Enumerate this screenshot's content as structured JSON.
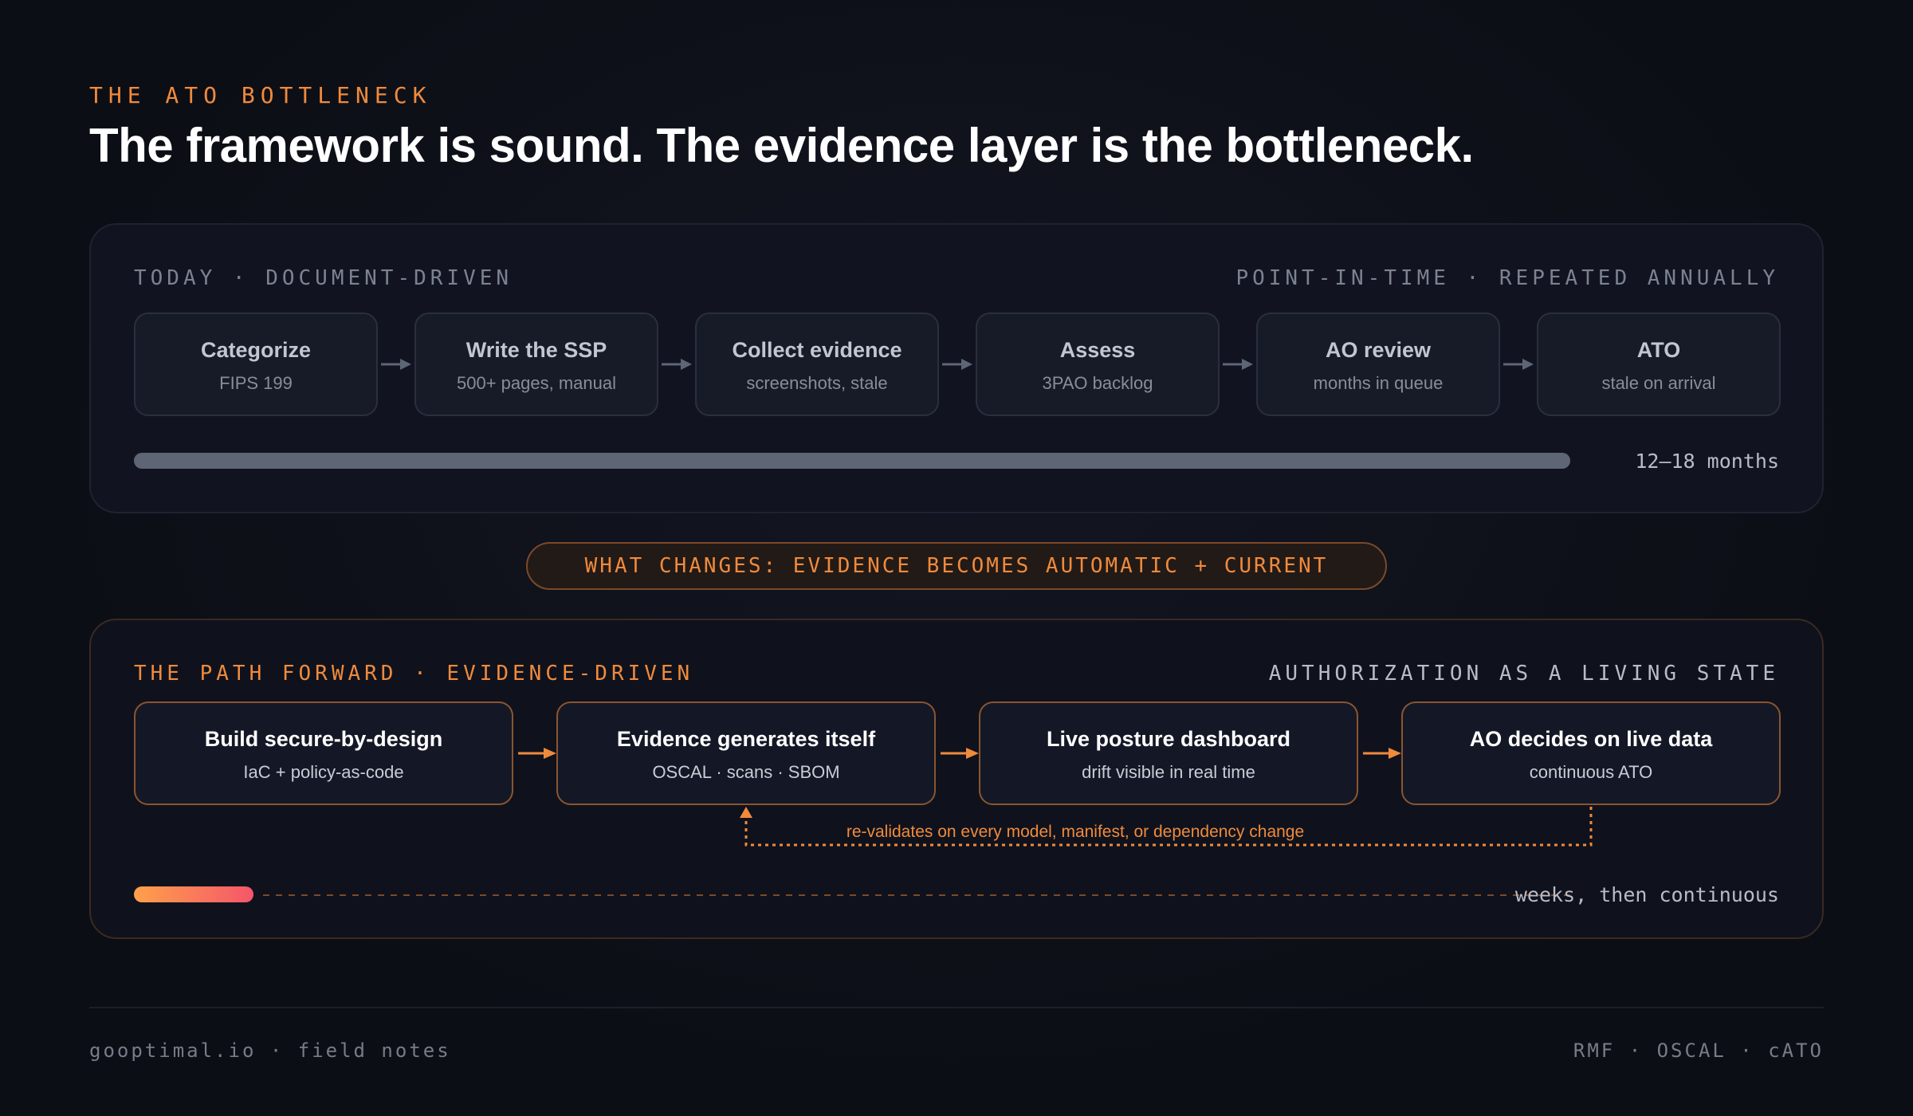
{
  "eyebrow": "THE ATO BOTTLENECK",
  "headline": "The framework is sound. The evidence layer is the bottleneck.",
  "today": {
    "label": "TODAY · DOCUMENT-DRIVEN",
    "cadence": "POINT-IN-TIME · REPEATED ANNUALLY",
    "steps": [
      {
        "title": "Categorize",
        "sub": "FIPS 199"
      },
      {
        "title": "Write the SSP",
        "sub": "500+ pages, manual"
      },
      {
        "title": "Collect evidence",
        "sub": "screenshots, stale"
      },
      {
        "title": "Assess",
        "sub": "3PAO backlog"
      },
      {
        "title": "AO review",
        "sub": "months in queue"
      },
      {
        "title": "ATO",
        "sub": "stale on arrival"
      }
    ],
    "duration": "12–18 months"
  },
  "pill": "WHAT CHANGES: EVIDENCE BECOMES AUTOMATIC + CURRENT",
  "future": {
    "label": "THE PATH FORWARD · EVIDENCE-DRIVEN",
    "cadence": "AUTHORIZATION AS A LIVING STATE",
    "steps": [
      {
        "title": "Build secure-by-design",
        "sub": "IaC + policy-as-code"
      },
      {
        "title": "Evidence generates itself",
        "sub": "OSCAL · scans · SBOM"
      },
      {
        "title": "Live posture dashboard",
        "sub": "drift visible in real time"
      },
      {
        "title": "AO decides on live data",
        "sub": "continuous ATO"
      }
    ],
    "loop_label": "re-validates on every model, manifest, or dependency change",
    "duration": "weeks, then continuous"
  },
  "footer": {
    "left": "gooptimal.io · field notes",
    "right": "RMF · OSCAL · cATO"
  },
  "colors": {
    "accent": "#f08a3c",
    "gradient_start": "#ffa04a",
    "gradient_end": "#f4566a",
    "grey_bar": "#5e6575"
  }
}
